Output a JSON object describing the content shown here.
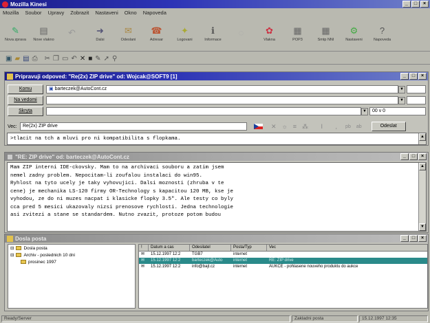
{
  "app": {
    "title": "Mozilla Kinesi"
  },
  "menu": [
    "Mozilla",
    "Soubor",
    "Upravy",
    "Zobrazit",
    "Nastaveni",
    "Okno",
    "Napoveda"
  ],
  "toolbar": [
    {
      "label": "Nova zprava",
      "icon": "new-message-icon"
    },
    {
      "label": "Nove vlakno",
      "icon": "new-thread-icon"
    },
    {
      "label": "",
      "icon": "reply-icon"
    },
    {
      "label": "Dalsi",
      "icon": "next-icon"
    },
    {
      "label": "Odeslani",
      "icon": "send-icon"
    },
    {
      "label": "Adresar",
      "icon": "address-book-icon"
    },
    {
      "label": "Logovani",
      "icon": "log-icon"
    },
    {
      "label": "Informace",
      "icon": "info-icon"
    },
    {
      "label": "",
      "icon": "blank-icon"
    },
    {
      "label": "Vlakna",
      "icon": "threads-icon"
    },
    {
      "label": "POP3",
      "icon": "pop3-icon"
    },
    {
      "label": "Smtp NNI",
      "icon": "smtp-icon"
    },
    {
      "label": "Nastaveni",
      "icon": "settings-icon"
    },
    {
      "label": "Napoveda",
      "icon": "help-icon"
    }
  ],
  "compose": {
    "title": "Pripravuji odpoved: \"Re(2x) ZIP drive\" od: Wojcak@SOFT9 [1]",
    "to_label": "Komu",
    "to_value": "barteczek@AutoCont.cz",
    "cc_label": "Na vedomi",
    "bcc_label": "Skryta",
    "size_value": "00 v 0",
    "subject_label": "Vec:",
    "subject_value": "Re(2x) ZIP drive",
    "send_label": "Odeslat",
    "body_line": ">tlacit na tch a mluvi pro ni kompatibilita s flopkama."
  },
  "message": {
    "title": "\"RE: ZIP drive\" od: barteczek@AutoCont.cz",
    "lines": [
      "Mam ZIP interni IDE-ckovsky. Mam to na archivaci souboru a zatim jsem",
      "nemel zadny problem. Nepocitam-li zoufalou instalaci do win95.",
      "Ryhlost na tyto ucely je taky vyhovujici. Dalsi moznosti (zhruba v te",
      "cene) je mechanika LS-120 firmy OR-Technology s kapacitou 120 MB, kse je",
      "vyhodou, ze do ni muzes nacpat i klasicke flopky 3.5\". Ale testy co byly",
      "cca pred 5 mesici ukazovaly nizsi prenosove rychlosti. Jedna technologie",
      "asi zvitezi a stane se standardem. Nutno zvazit, protoze potom budou"
    ]
  },
  "folders": {
    "title": "Dosla posta",
    "tree": [
      "Dosla posta",
      "Archiv - poslednich 10 dni",
      "prosinec 1997"
    ],
    "columns": [
      "!",
      "Datum a cas",
      "Odesilatel",
      "Posta/Typ",
      "Vec"
    ],
    "rows": [
      [
        "",
        "15.12.1997 12:2",
        "TGB7",
        "internet",
        ""
      ],
      [
        "",
        "15.12.1997 12:2",
        "barteczek@Auto",
        "internet",
        "RE: ZIP drive"
      ],
      [
        "",
        "15.12.1997 12:2",
        "info@bajt.cz",
        "internet",
        "AUKCE - pohlasene nouveho produktu do aukce"
      ]
    ]
  },
  "status": {
    "left": "Ready/Server",
    "mid": "Zakladni posta",
    "right": "15.12.1997 12:35"
  },
  "colors": {
    "titlebar": "#1c1e8a",
    "selection": "#2a8a8a"
  }
}
